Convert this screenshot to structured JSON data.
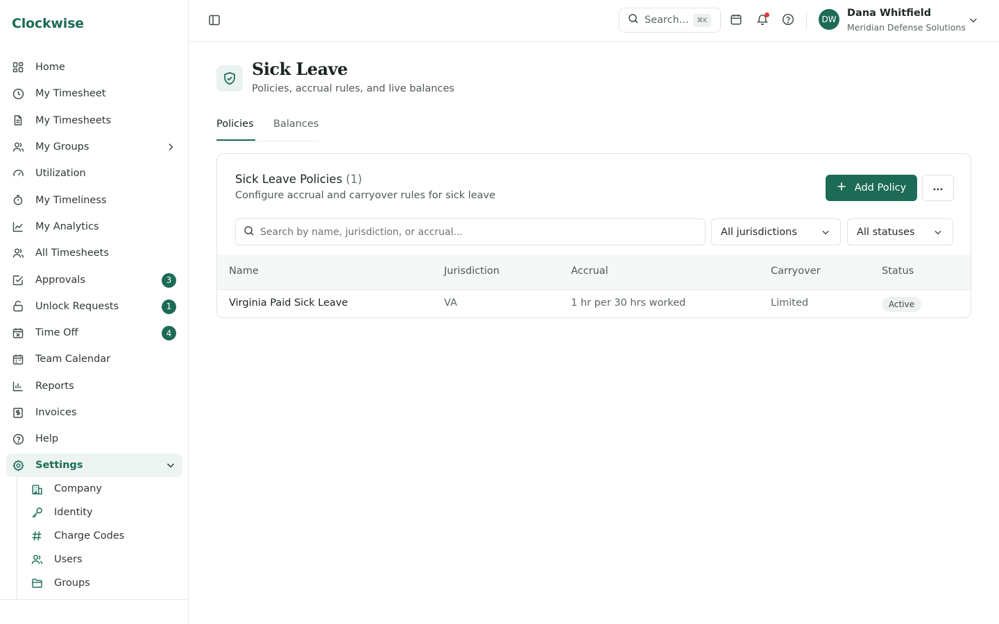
{
  "app": {
    "brand": "Clockwise"
  },
  "colors": {
    "accent": "#1d6b56",
    "notification": "#e23b3b"
  },
  "sidebar": {
    "items": [
      {
        "label": "Home",
        "icon": "home-grid-icon"
      },
      {
        "label": "My Timesheet",
        "icon": "clock-icon"
      },
      {
        "label": "My Timesheets",
        "icon": "document-icon"
      },
      {
        "label": "My Groups",
        "icon": "users-icon"
      },
      {
        "label": "Utilization",
        "icon": "gauge-icon"
      },
      {
        "label": "My Timeliness",
        "icon": "timer-icon"
      },
      {
        "label": "My Analytics",
        "icon": "line-chart-icon"
      },
      {
        "label": "All Timesheets",
        "icon": "users-icon"
      },
      {
        "label": "Approvals",
        "icon": "check-square-icon",
        "badge": "3"
      },
      {
        "label": "Unlock Requests",
        "icon": "unlock-icon",
        "badge": "1"
      },
      {
        "label": "Time Off",
        "icon": "calendar-x-icon",
        "badge": "4"
      },
      {
        "label": "Team Calendar",
        "icon": "calendar-icon"
      },
      {
        "label": "Reports",
        "icon": "bar-chart-icon"
      },
      {
        "label": "Invoices",
        "icon": "dollar-receipt-icon"
      },
      {
        "label": "Help",
        "icon": "help-circle-icon"
      },
      {
        "label": "Settings",
        "icon": "gear-icon"
      }
    ],
    "settings_sub": [
      {
        "label": "Company",
        "icon": "building-icon"
      },
      {
        "label": "Identity",
        "icon": "key-icon"
      },
      {
        "label": "Charge Codes",
        "icon": "hash-icon"
      },
      {
        "label": "Users",
        "icon": "users-icon"
      },
      {
        "label": "Groups",
        "icon": "folder-icon"
      }
    ]
  },
  "topbar": {
    "search_label": "Search...",
    "search_shortcut": "⌘K",
    "user": {
      "initials": "DW",
      "name": "Dana Whitfield",
      "org": "Meridian Defense Solutions"
    }
  },
  "page": {
    "title": "Sick Leave",
    "subtitle": "Policies, accrual rules, and live balances",
    "tabs": [
      {
        "label": "Policies"
      },
      {
        "label": "Balances"
      }
    ]
  },
  "card": {
    "title": "Sick Leave Policies",
    "count": "(1)",
    "subtitle": "Configure accrual and carryover rules for sick leave",
    "add_label": "Add Policy",
    "search_placeholder": "Search by name, jurisdiction, or accrual...",
    "filter_jurisdiction": "All jurisdictions",
    "filter_status": "All statuses",
    "columns": [
      "Name",
      "Jurisdiction",
      "Accrual",
      "Carryover",
      "Status"
    ],
    "rows": [
      {
        "name": "Virginia Paid Sick Leave",
        "jurisdiction": "VA",
        "accrual": "1 hr per 30 hrs worked",
        "carryover": "Limited",
        "status": "Active"
      }
    ]
  }
}
